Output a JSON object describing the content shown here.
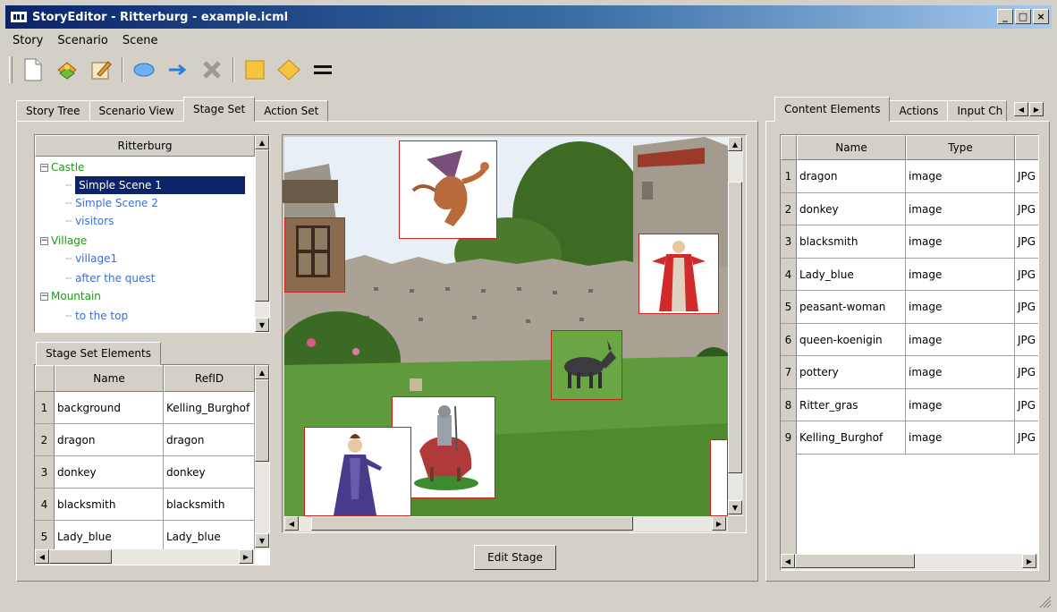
{
  "window": {
    "title": "StoryEditor - Ritterburg - example.icml"
  },
  "menu": [
    "Story",
    "Scenario",
    "Scene"
  ],
  "toolbar": {
    "icons": [
      "new-document-icon",
      "open-icon",
      "edit-icon",
      "ellipse-icon",
      "arrow-right-icon",
      "delete-icon",
      "rectangle-icon",
      "diamond-icon",
      "equals-icon"
    ]
  },
  "left_tabs": [
    "Story Tree",
    "Scenario View",
    "Stage Set",
    "Action Set"
  ],
  "left_tabs_active": "Stage Set",
  "tree": {
    "header": "Ritterburg",
    "items": [
      {
        "label": "Castle",
        "level": 0,
        "expander": "−"
      },
      {
        "label": "Simple Scene 1",
        "level": 1,
        "selected": true
      },
      {
        "label": "Simple Scene 2",
        "level": 1
      },
      {
        "label": "visitors",
        "level": 1
      },
      {
        "label": "Village",
        "level": 0,
        "expander": "−"
      },
      {
        "label": "village1",
        "level": 1
      },
      {
        "label": "after the quest",
        "level": 1
      },
      {
        "label": "Mountain",
        "level": 0,
        "expander": "−"
      },
      {
        "label": "to the top",
        "level": 1
      }
    ]
  },
  "stage_elements": {
    "tab": "Stage Set Elements",
    "columns": [
      "Name",
      "RefID"
    ],
    "rows": [
      [
        "1",
        "background",
        "Kelling_Burghof"
      ],
      [
        "2",
        "dragon",
        "dragon"
      ],
      [
        "3",
        "donkey",
        "donkey"
      ],
      [
        "4",
        "blacksmith",
        "blacksmith"
      ],
      [
        "5",
        "Lady_blue",
        "Lady_blue"
      ]
    ]
  },
  "stage": {
    "edit_button": "Edit Stage"
  },
  "right_tabs": [
    "Content Elements",
    "Actions",
    "Input Ch"
  ],
  "right_tabs_active": "Content Elements",
  "content_elements": {
    "columns": [
      "Name",
      "Type",
      ""
    ],
    "rows": [
      [
        "1",
        "dragon",
        "image",
        "JPG"
      ],
      [
        "2",
        "donkey",
        "image",
        "JPG"
      ],
      [
        "3",
        "blacksmith",
        "image",
        "JPG"
      ],
      [
        "4",
        "Lady_blue",
        "image",
        "JPG"
      ],
      [
        "5",
        "peasant-woman",
        "image",
        "JPG"
      ],
      [
        "6",
        "queen-koenigin",
        "image",
        "JPG"
      ],
      [
        "7",
        "pottery",
        "image",
        "JPG"
      ],
      [
        "8",
        "Ritter_gras",
        "image",
        "JPG"
      ],
      [
        "9",
        "Kelling_Burghof",
        "image",
        "JPG"
      ]
    ]
  },
  "colors": {
    "titlebar_start": "#0a246a",
    "titlebar_end": "#a6caf0",
    "tree_group": "#1a9a1a",
    "tree_leaf": "#3a6fd0",
    "selection": "#0a246a",
    "sprite_border": "#cc2020"
  }
}
